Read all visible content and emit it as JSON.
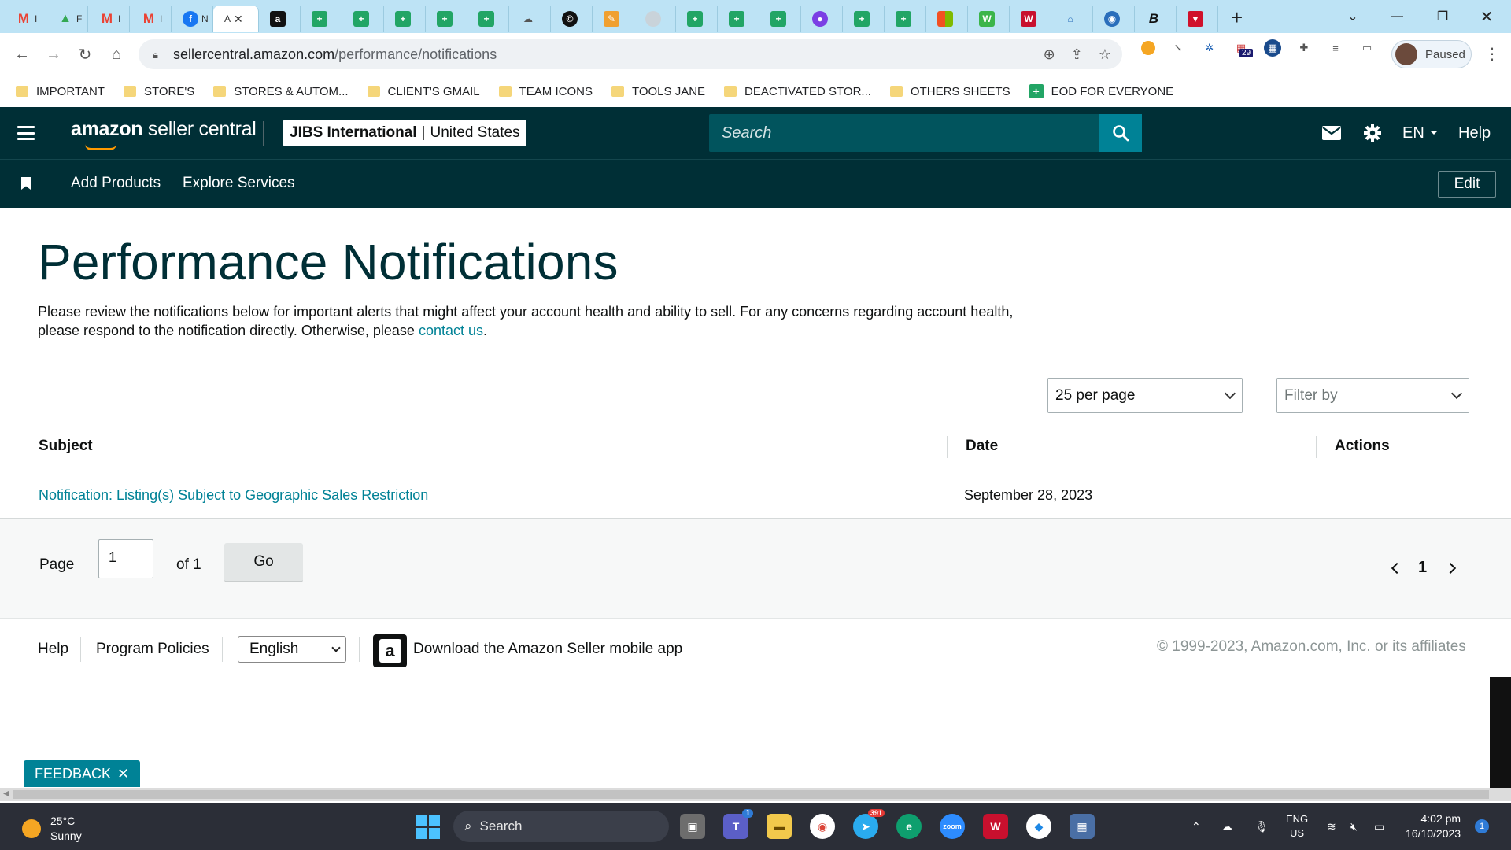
{
  "browser": {
    "tabs": [
      {
        "icon": "gmail-icon",
        "text": "I",
        "color": "#ea4335",
        "glyph": "M"
      },
      {
        "icon": "drive-icon",
        "text": "F",
        "color": "#34a853",
        "glyph": "▲"
      },
      {
        "icon": "gmail-icon",
        "text": "I",
        "color": "#ea4335",
        "glyph": "M"
      },
      {
        "icon": "gmail-icon",
        "text": "I",
        "color": "#ea4335",
        "glyph": "M"
      },
      {
        "icon": "facebook-icon",
        "text": "N",
        "color": "#1877f2",
        "glyph": "f"
      }
    ],
    "active_tab": {
      "text": "A"
    },
    "address": {
      "host": "sellercentral.amazon.com",
      "path": "/performance/notifications"
    },
    "profile_label": "Paused",
    "bookmarks": [
      "IMPORTANT",
      "STORE'S",
      "STORES & AUTOM...",
      "CLIENT'S GMAIL",
      "TEAM ICONS",
      "TOOLS JANE",
      "DEACTIVATED STOR...",
      "OTHERS SHEETS"
    ],
    "bookmark_sheet": "EOD FOR EVERYONE",
    "extension_badge": "29"
  },
  "header": {
    "logo_bold": "amazon",
    "logo_rest": " seller central",
    "account_name": "JIBS International",
    "account_region": "United States",
    "search_placeholder": "Search",
    "language": "EN",
    "help": "Help"
  },
  "nav": {
    "links": [
      "Add Products",
      "Explore Services"
    ],
    "edit": "Edit"
  },
  "page": {
    "title": "Performance Notifications",
    "intro_text": "Please review the notifications below for important alerts that might affect your account health and ability to sell. For any concerns regarding account health, please respond to the notification directly. Otherwise, please ",
    "intro_link": "contact us",
    "intro_end": ".",
    "per_page": "25 per page",
    "filter_placeholder": "Filter by"
  },
  "table": {
    "headers": [
      "Subject",
      "Date",
      "Actions"
    ],
    "rows": [
      {
        "subject": "Notification: Listing(s) Subject to Geographic Sales Restriction",
        "date": "September 28, 2023",
        "actions": ""
      }
    ]
  },
  "pager": {
    "page_label": "Page",
    "page_value": "1",
    "of_label": "of 1",
    "go": "Go",
    "current": "1"
  },
  "footer": {
    "help": "Help",
    "policies": "Program Policies",
    "language": "English",
    "app_text": "Download the Amazon Seller mobile app",
    "copyright": "© 1999-2023, Amazon.com, Inc. or its affiliates"
  },
  "feedback": "FEEDBACK",
  "taskbar": {
    "temp": "25°C",
    "condition": "Sunny",
    "search": "Search",
    "lang_top": "ENG",
    "lang_bottom": "US",
    "time": "4:02 pm",
    "date": "16/10/2023",
    "teams_badge": "1",
    "telegram_badge": "391",
    "notif_badge": "1"
  }
}
